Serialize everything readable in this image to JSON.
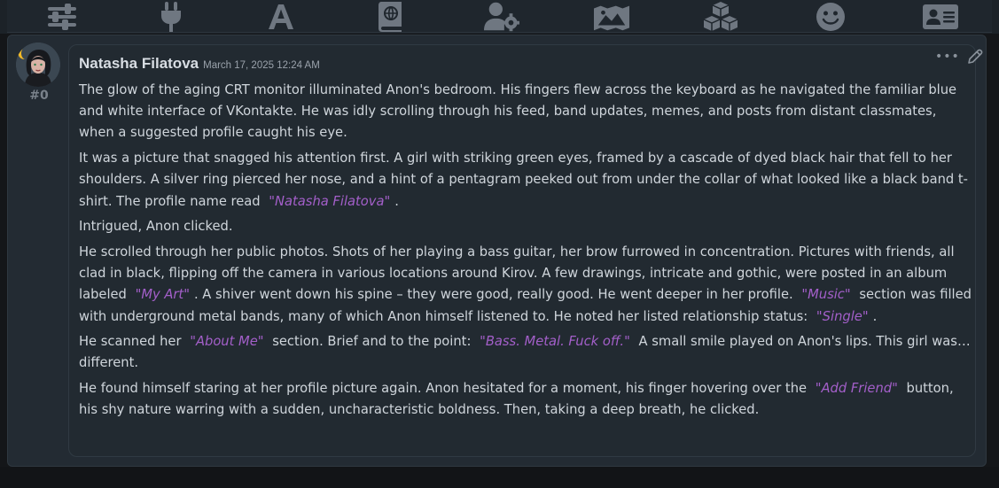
{
  "toolbar": {
    "icons": [
      {
        "name": "sliders-icon"
      },
      {
        "name": "plug-icon"
      },
      {
        "name": "font-icon"
      },
      {
        "name": "book-atlas-icon"
      },
      {
        "name": "user-gear-icon"
      },
      {
        "name": "image-icon"
      },
      {
        "name": "cubes-icon"
      },
      {
        "name": "smile-icon"
      },
      {
        "name": "id-card-icon"
      }
    ]
  },
  "message": {
    "index": "#0",
    "author": "Natasha Filatova",
    "timestamp": "March 17, 2025 12:24 AM",
    "more_glyph": "•••",
    "paragraphs": {
      "p1": "The glow of the aging CRT monitor illuminated Anon's bedroom. His fingers flew across the keyboard as he navigated the familiar blue and white interface of VKontakte. He was idly scrolling through his feed, band updates, memes, and posts from distant classmates, when a suggested profile caught his eye.",
      "p2a": "It was a picture that snagged his attention first. A girl with striking green eyes, framed by a cascade of dyed black hair that fell to her shoulders. A silver ring pierced her nose, and a hint of a pentagram peeked out from under the collar of what looked like a black band t-shirt. The profile name read",
      "p2q": "\"Natasha Filatova\"",
      "p2b": ".",
      "p3": "Intrigued, Anon clicked.",
      "p4a": "He scrolled through her public photos. Shots of her playing a bass guitar, her brow furrowed in concentration. Pictures with friends, all clad in black, flipping off the camera in various locations around Kirov. A few drawings, intricate and gothic, were posted in an album labeled",
      "p4q1": "\"My Art\"",
      "p4b": ". A shiver went down his spine – they were good, really good. He went deeper in her profile.",
      "p4q2": "\"Music\"",
      "p4c": "section was filled with underground metal bands, many of which Anon himself listened to. He noted her listed relationship status:",
      "p4q3": "\"Single\"",
      "p4d": ".",
      "p5a": "He scanned her",
      "p5q1": "\"About Me\"",
      "p5b": "section. Brief and to the point:",
      "p5q2": "\"Bass. Metal. Fuck off.\"",
      "p5c": "A small smile played on Anon's lips. This girl was… different.",
      "p6a": "He found himself staring at her profile picture again. Anon hesitated for a moment, his finger hovering over the",
      "p6q": "\"Add Friend\"",
      "p6b": "button, his shy nature warring with a sudden, uncharacteristic boldness. Then, taking a deep breath, he clicked."
    }
  },
  "colors": {
    "background": "#141619",
    "card": "#232b33",
    "text": "#cfd5db",
    "quote": "#a35fc9",
    "icons": "#6f7781"
  }
}
